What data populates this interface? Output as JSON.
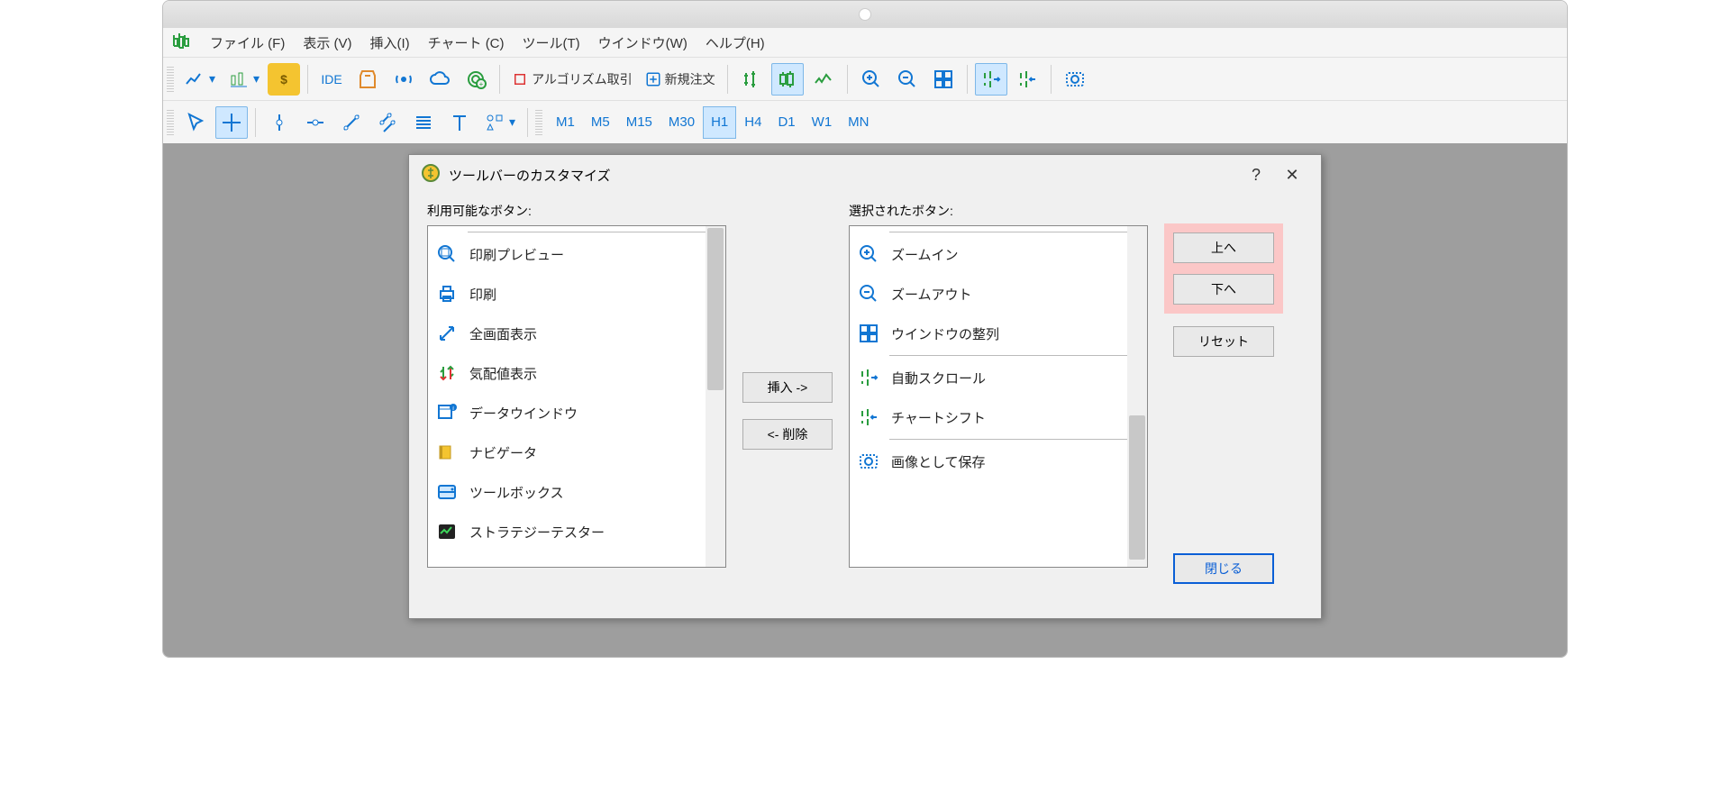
{
  "menu": {
    "items": [
      "ファイル (F)",
      "表示 (V)",
      "挿入(I)",
      "チャート (C)",
      "ツール(T)",
      "ウインドウ(W)",
      "ヘルプ(H)"
    ]
  },
  "toolbar1": {
    "ide": "IDE",
    "algo": "アルゴリズム取引",
    "neworder": "新規注文"
  },
  "toolbar2": {
    "timeframes": [
      "M1",
      "M5",
      "M15",
      "M30",
      "H1",
      "H4",
      "D1",
      "W1",
      "MN"
    ],
    "active_tf": "H1"
  },
  "dialog": {
    "title": "ツールバーのカスタマイズ",
    "available_label": "利用可能なボタン:",
    "selected_label": "選択されたボタン:",
    "available": [
      {
        "icon": "print-preview",
        "label": "印刷プレビュー"
      },
      {
        "icon": "print",
        "label": "印刷"
      },
      {
        "icon": "fullscreen",
        "label": "全画面表示"
      },
      {
        "icon": "market-watch",
        "label": "気配値表示"
      },
      {
        "icon": "data-window",
        "label": "データウインドウ"
      },
      {
        "icon": "navigator",
        "label": "ナビゲータ"
      },
      {
        "icon": "toolbox",
        "label": "ツールボックス"
      },
      {
        "icon": "strategy-tester",
        "label": "ストラテジーテスター"
      }
    ],
    "selected_groups": [
      [
        {
          "icon": "zoom-in",
          "label": "ズームイン"
        },
        {
          "icon": "zoom-out",
          "label": "ズームアウト"
        },
        {
          "icon": "tile",
          "label": "ウインドウの整列"
        }
      ],
      [
        {
          "icon": "autoscroll",
          "label": "自動スクロール"
        },
        {
          "icon": "chartshift",
          "label": "チャートシフト"
        }
      ],
      [
        {
          "icon": "save-image",
          "label": "画像として保存"
        }
      ]
    ],
    "insert_btn": "挿入 ->",
    "remove_btn": "<- 削除",
    "up_btn": "上へ",
    "down_btn": "下へ",
    "reset_btn": "リセット",
    "close_btn": "閉じる"
  }
}
